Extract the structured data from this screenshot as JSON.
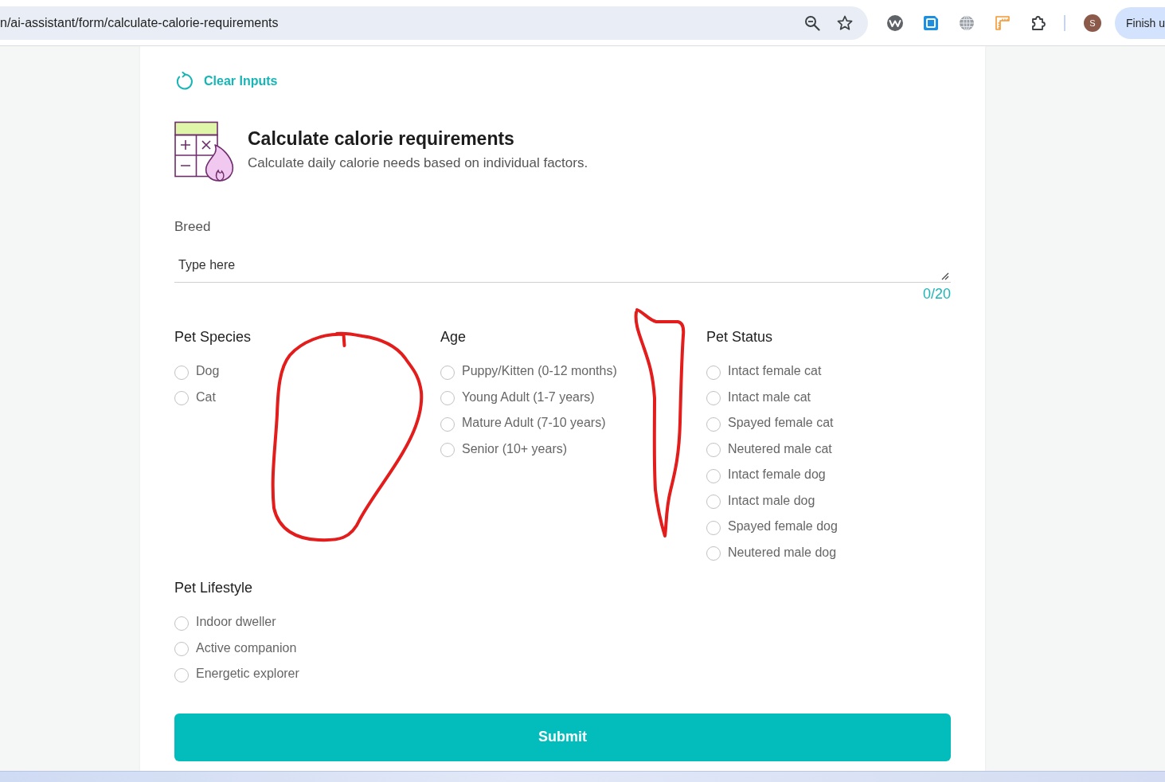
{
  "browser": {
    "url": "n/ai-assistant/form/calculate-calorie-requirements",
    "profile_initial": "S",
    "action_button": "Finish u"
  },
  "form": {
    "clear_button": "Clear Inputs",
    "title": "Calculate calorie requirements",
    "subtitle": "Calculate daily calorie needs based on individual factors.",
    "breed": {
      "label": "Breed",
      "placeholder": "Type here",
      "counter": "0/20"
    },
    "groups": [
      {
        "title": "Pet Species",
        "options": [
          {
            "label": "Dog",
            "selected": false
          },
          {
            "label": "Cat",
            "selected": false
          }
        ]
      },
      {
        "title": "Age",
        "options": [
          {
            "label": "Puppy/Kitten (0-12 months)",
            "selected": false
          },
          {
            "label": "Young Adult (1-7 years)",
            "selected": false
          },
          {
            "label": "Mature Adult (7-10 years)",
            "selected": false
          },
          {
            "label": "Senior (10+ years)",
            "selected": false
          }
        ]
      },
      {
        "title": "Pet Status",
        "options": [
          {
            "label": "Intact female cat",
            "selected": false
          },
          {
            "label": "Intact male cat",
            "selected": false
          },
          {
            "label": "Spayed female cat",
            "selected": false
          },
          {
            "label": "Neutered male cat",
            "selected": false
          },
          {
            "label": "Intact female dog",
            "selected": false
          },
          {
            "label": "Intact male dog",
            "selected": false
          },
          {
            "label": "Spayed female dog",
            "selected": false
          },
          {
            "label": "Neutered male dog",
            "selected": false
          }
        ]
      },
      {
        "title": "Pet Lifestyle",
        "options": [
          {
            "label": "Indoor dweller",
            "selected": false
          },
          {
            "label": "Active companion",
            "selected": false
          },
          {
            "label": "Energetic explorer",
            "selected": false
          }
        ]
      }
    ],
    "submit": "Submit"
  }
}
